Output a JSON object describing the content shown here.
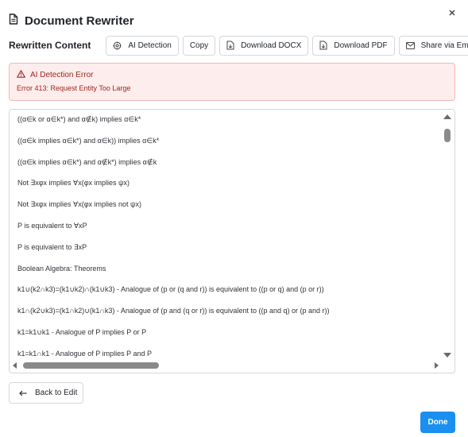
{
  "dialog": {
    "title": "Document Rewriter",
    "close_icon": "close-icon"
  },
  "toolbar": {
    "label": "Rewritten Content",
    "buttons": [
      {
        "label": "AI Detection",
        "icon": "ai-detection-icon"
      },
      {
        "label": "Copy",
        "icon": ""
      },
      {
        "label": "Download DOCX",
        "icon": "document-download-icon"
      },
      {
        "label": "Download PDF",
        "icon": "document-download-icon"
      },
      {
        "label": "Share via Email",
        "icon": "mail-icon"
      }
    ]
  },
  "alert": {
    "title": "AI Detection Error",
    "message": "Error 413: Request Entity Too Large",
    "icon": "warning-icon"
  },
  "content": {
    "lines": [
      "((α∈k or α∈k*) and α∉k) implies α∈k*",
      "((α∈k implies α∈k*) and α∈k)) implies α∈k*",
      "((α∈k implies α∈k*) and α∉k*) implies α∉k",
      "Not ∃xφx implies ∀x(φx implies ψx)",
      "Not ∃xφx implies ∀x(φx implies not ψx)",
      "P is equivalent to ∀xP",
      "P is equivalent to ∃xP",
      "Boolean Algebra: Theorems",
      "k1∪(k2∩k3)=(k1∪k2)∩(k1∪k3) - Analogue of (p or (q and r)) is equivalent to ((p or q) and (p or r))",
      "k1∩(k2∪k3)=(k1∩k2)∪(k1∩k3) - Analogue of (p and (q or r)) is equivalent to ((p and q) or (p and r))",
      "k1=k1∪k1 - Analogue of P implies P or P",
      "k1=k1∩k1 - Analogue of P implies P and P"
    ]
  },
  "footer": {
    "back_label": "Back to Edit",
    "back_icon": "arrow-left-icon",
    "done_label": "Done"
  },
  "colors": {
    "primary": "#1a8ff0",
    "error_bg": "#fdeded",
    "error_text": "#a1261f"
  }
}
